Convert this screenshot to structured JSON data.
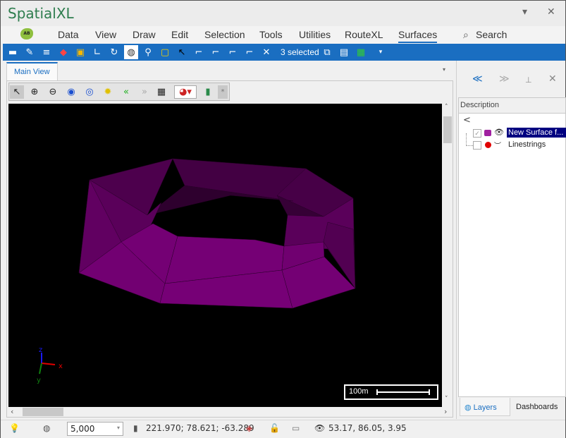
{
  "app": {
    "title": "SpatialXL",
    "window_buttons": {
      "dropdown": "▾",
      "close": "✕"
    }
  },
  "menu": {
    "logo_text": "AB",
    "items": [
      {
        "label": "Data"
      },
      {
        "label": "View"
      },
      {
        "label": "Draw"
      },
      {
        "label": "Edit"
      },
      {
        "label": "Selection"
      },
      {
        "label": "Tools"
      },
      {
        "label": "Utilities"
      },
      {
        "label": "RouteXL"
      },
      {
        "label": "Surfaces",
        "active": true
      }
    ],
    "search_icon": "⌕",
    "search_label": "Search"
  },
  "toolbar": {
    "icons": [
      "open-folder-icon",
      "palette-icon",
      "layers-stack-icon",
      "maps-pin-icon",
      "draw-frame-icon",
      "measure-angle-icon",
      "axis-rotate-icon",
      "globe-icon",
      "location-pin-icon",
      "select-rect-icon",
      "select-point-icon",
      "select-vertex-icon",
      "select-polygon-icon",
      "select-line-icon",
      "select-clip-icon",
      "clear-selection-icon"
    ],
    "selection_count_label": "3 selected",
    "after_icons": [
      "zoom-to-selection-icon",
      "attribute-table-icon",
      "export-excel-icon"
    ],
    "more": "▾"
  },
  "document": {
    "tab_label": "Main View",
    "dropdown": "▾"
  },
  "view_tools": {
    "icons": [
      "pointer-icon",
      "zoom-in-icon",
      "zoom-out-icon",
      "full-extent-icon",
      "zoom-extent-icon",
      "settings-gear-icon",
      "previous-view-icon",
      "next-view-icon",
      "grid-icon",
      "color-theme-icon",
      "bookmark-icon"
    ],
    "asterisk": "*"
  },
  "viewport": {
    "background": "#000000",
    "surface_color": "#750075",
    "axes": {
      "x": "x",
      "y": "y",
      "z": "z"
    },
    "scale_label": "100m"
  },
  "side_panel": {
    "back_icon": "≪",
    "forward_icon": "≫",
    "pin_icon": "⊥",
    "close_icon": "✕",
    "column_header": "Description",
    "back_row": "<",
    "layers": [
      {
        "name": "New Surface f...",
        "checked": true,
        "selected": true,
        "symbol_color": "#a020a0",
        "visible": true
      },
      {
        "name": "Linestrings",
        "checked": false,
        "selected": false,
        "symbol_color": "#e00000",
        "visible": false
      }
    ],
    "tabs": [
      {
        "label": "Layers",
        "active": true
      },
      {
        "label": "Dashboards",
        "active": false
      }
    ]
  },
  "status": {
    "scale_value": "5,000",
    "cursor_coords": "221.970; 78.621; -63.289",
    "camera_coords": "53.17, 86.05, 3.95"
  }
}
